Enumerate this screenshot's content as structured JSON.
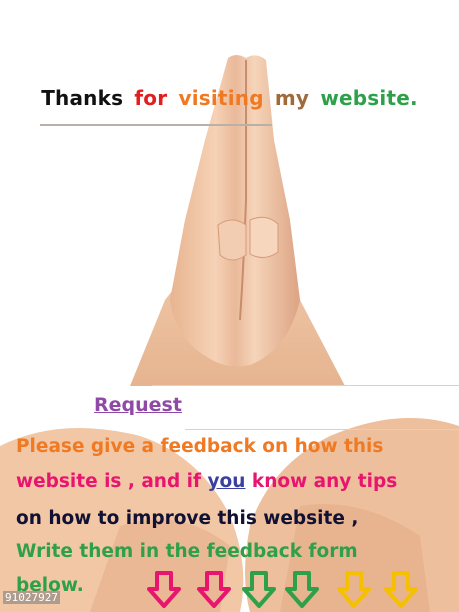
{
  "thanks": {
    "words": [
      {
        "text": "Thanks",
        "color": "#111111"
      },
      {
        "text": "for",
        "color": "#e0201f"
      },
      {
        "text": "visiting",
        "color": "#f07a23"
      },
      {
        "text": "my",
        "color": "#a06a3a"
      },
      {
        "text": "website.",
        "color": "#2fa04a"
      }
    ]
  },
  "request": {
    "label": "Request",
    "color": "#8e4aa6"
  },
  "message": {
    "line1": {
      "text": "Please give a feedback on how this",
      "color": "#f07a23"
    },
    "line2_a": {
      "text": "website is , and if ",
      "color": "#e8156e"
    },
    "line2_you": {
      "text": "you",
      "color": "#3b3fa0"
    },
    "line2_b": {
      "text": " know any tips",
      "color": "#e8156e"
    },
    "line3": {
      "text": "on how to improve this website ,",
      "color": "#111133"
    },
    "line4": {
      "text": "Write them in the feedback form",
      "color": "#2fa04a"
    },
    "line5": {
      "text": "below.",
      "color": "#2fa04a"
    }
  },
  "counter": {
    "value": "91027927"
  },
  "arrows": [
    {
      "icon": "down-arrow-icon",
      "color": "#e8156e"
    },
    {
      "icon": "down-arrow-icon",
      "color": "#e8156e"
    },
    {
      "icon": "down-arrow-icon",
      "color": "#2fa04a"
    },
    {
      "icon": "down-arrow-icon",
      "color": "#2fa04a"
    },
    {
      "icon": "down-arrow-icon",
      "color": "#f5c000"
    },
    {
      "icon": "down-arrow-icon",
      "color": "#f5c000"
    }
  ]
}
